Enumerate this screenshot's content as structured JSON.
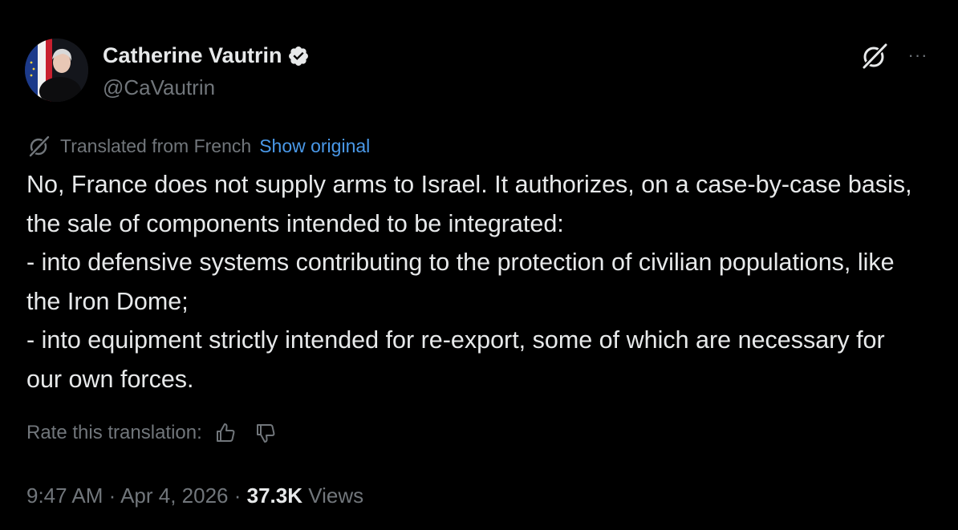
{
  "author": {
    "display_name": "Catherine Vautrin",
    "handle": "@CaVautrin",
    "verified": true,
    "avatar_icon": "profile-photo"
  },
  "header_actions": {
    "grok_icon": "grok-icon",
    "more_label": "···"
  },
  "translation": {
    "notice": "Translated from French",
    "show_original": "Show original"
  },
  "tweet": {
    "lines": [
      "No, France does not supply arms to Israel. It authorizes, on a case-by-case basis, the sale of components intended to be integrated:",
      "- into defensive systems contributing to the protection of civilian populations, like the Iron Dome;",
      "- into equipment strictly intended for re-export, some of which are necessary for our own forces."
    ]
  },
  "rating": {
    "label": "Rate this translation:",
    "thumbs_up_icon": "thumbs-up-icon",
    "thumbs_down_icon": "thumbs-down-icon"
  },
  "meta": {
    "time": "9:47 AM",
    "separator": " · ",
    "date": "Apr 4, 2026",
    "views_count": "37.3K",
    "views_label": "Views"
  },
  "colors": {
    "background": "#000000",
    "text_primary": "#e7e9ea",
    "text_secondary": "#71767b",
    "link": "#4a99e9",
    "verified_badge": "#e7e9ea"
  }
}
